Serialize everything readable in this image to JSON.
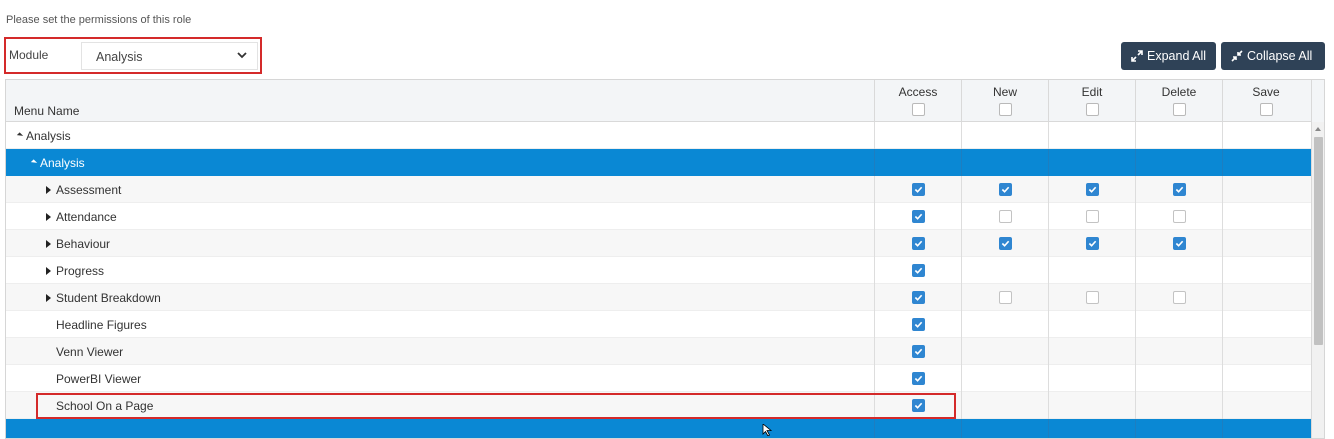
{
  "instruction": "Please set the permissions of this role",
  "module": {
    "label": "Module",
    "value": "Analysis"
  },
  "toolbar": {
    "expand_label": "Expand All",
    "collapse_label": "Collapse All"
  },
  "grid": {
    "name_header": "Menu Name",
    "columns": [
      "Access",
      "New",
      "Edit",
      "Delete",
      "Save"
    ]
  },
  "rows": [
    {
      "name": "Analysis",
      "level": 0,
      "toggle": "expanded",
      "checks": [
        null,
        null,
        null,
        null,
        null
      ]
    },
    {
      "name": "Analysis",
      "level": 1,
      "toggle": "expanded",
      "selected": true,
      "checks": [
        null,
        null,
        null,
        null,
        null
      ]
    },
    {
      "name": "Assessment",
      "level": 2,
      "toggle": "collapsed",
      "checks": [
        true,
        true,
        true,
        true,
        null
      ]
    },
    {
      "name": "Attendance",
      "level": 2,
      "toggle": "collapsed",
      "checks": [
        true,
        false,
        false,
        false,
        null
      ]
    },
    {
      "name": "Behaviour",
      "level": 2,
      "toggle": "collapsed",
      "checks": [
        true,
        true,
        true,
        true,
        null
      ]
    },
    {
      "name": "Progress",
      "level": 2,
      "toggle": "collapsed",
      "checks": [
        true,
        null,
        null,
        null,
        null
      ]
    },
    {
      "name": "Student Breakdown",
      "level": 2,
      "toggle": "collapsed",
      "checks": [
        true,
        false,
        false,
        false,
        null
      ]
    },
    {
      "name": "Headline Figures",
      "level": 2,
      "toggle": "none",
      "checks": [
        true,
        null,
        null,
        null,
        null
      ]
    },
    {
      "name": "Venn Viewer",
      "level": 2,
      "toggle": "none",
      "checks": [
        true,
        null,
        null,
        null,
        null
      ]
    },
    {
      "name": "PowerBI Viewer",
      "level": 2,
      "toggle": "none",
      "checks": [
        true,
        null,
        null,
        null,
        null
      ]
    },
    {
      "name": "School On a Page",
      "level": 2,
      "toggle": "none",
      "checks": [
        true,
        null,
        null,
        null,
        null
      ]
    },
    {
      "name": "",
      "level": 1,
      "toggle": "none",
      "selected": true,
      "checks": [
        null,
        null,
        null,
        null,
        null
      ]
    }
  ],
  "colors": {
    "selected_row": "#0a88d4",
    "checkbox_on": "#2f86d1",
    "button_bg": "#2f4257",
    "highlight": "#d42a2a"
  }
}
